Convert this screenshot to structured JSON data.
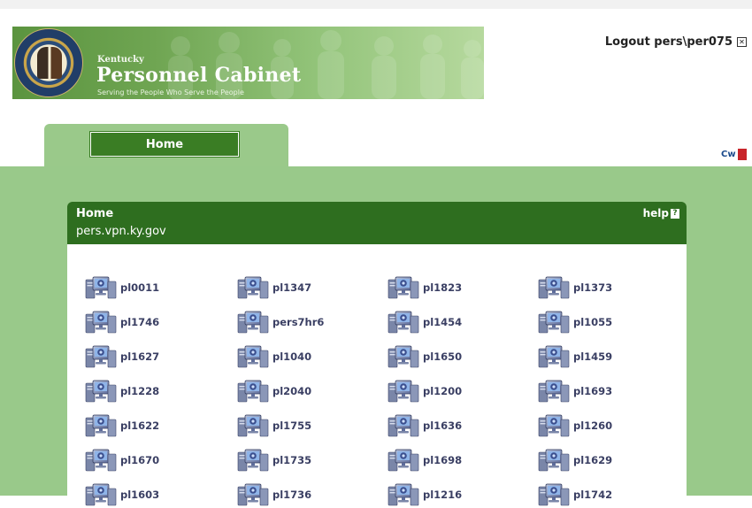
{
  "header": {
    "org_small": "Kentucky",
    "org_title": "Personnel Cabinet",
    "tagline": "Serving the People Who Serve the People",
    "logout_label": "Logout pers\\per075"
  },
  "tabs": [
    {
      "label": "Home",
      "active": true
    }
  ],
  "panel": {
    "title": "Home",
    "subtitle": "pers.vpn.ky.gov",
    "help_label": "help"
  },
  "computers": [
    [
      "pl0011",
      "pl1347",
      "pl1823",
      "pl1373"
    ],
    [
      "pl1746",
      "pers7hr6",
      "pl1454",
      "pl1055"
    ],
    [
      "pl1627",
      "pl1040",
      "pl1650",
      "pl1459"
    ],
    [
      "pl1228",
      "pl2040",
      "pl1200",
      "pl1693"
    ],
    [
      "pl1622",
      "pl1755",
      "pl1636",
      "pl1260"
    ],
    [
      "pl1670",
      "pl1735",
      "pl1698",
      "pl1629"
    ],
    [
      "pl1603",
      "pl1736",
      "pl1216",
      "pl1742"
    ]
  ],
  "icons": {
    "computer": "computer-icon",
    "close": "close-icon",
    "help": "help-icon",
    "cw_logo": "cw-logo-icon"
  },
  "colors": {
    "banner_green": "#6fa552",
    "tab_green": "#3a7d24",
    "panel_header": "#2e6e1f",
    "background_green": "#99c98a",
    "link_text": "#3a3f63"
  }
}
